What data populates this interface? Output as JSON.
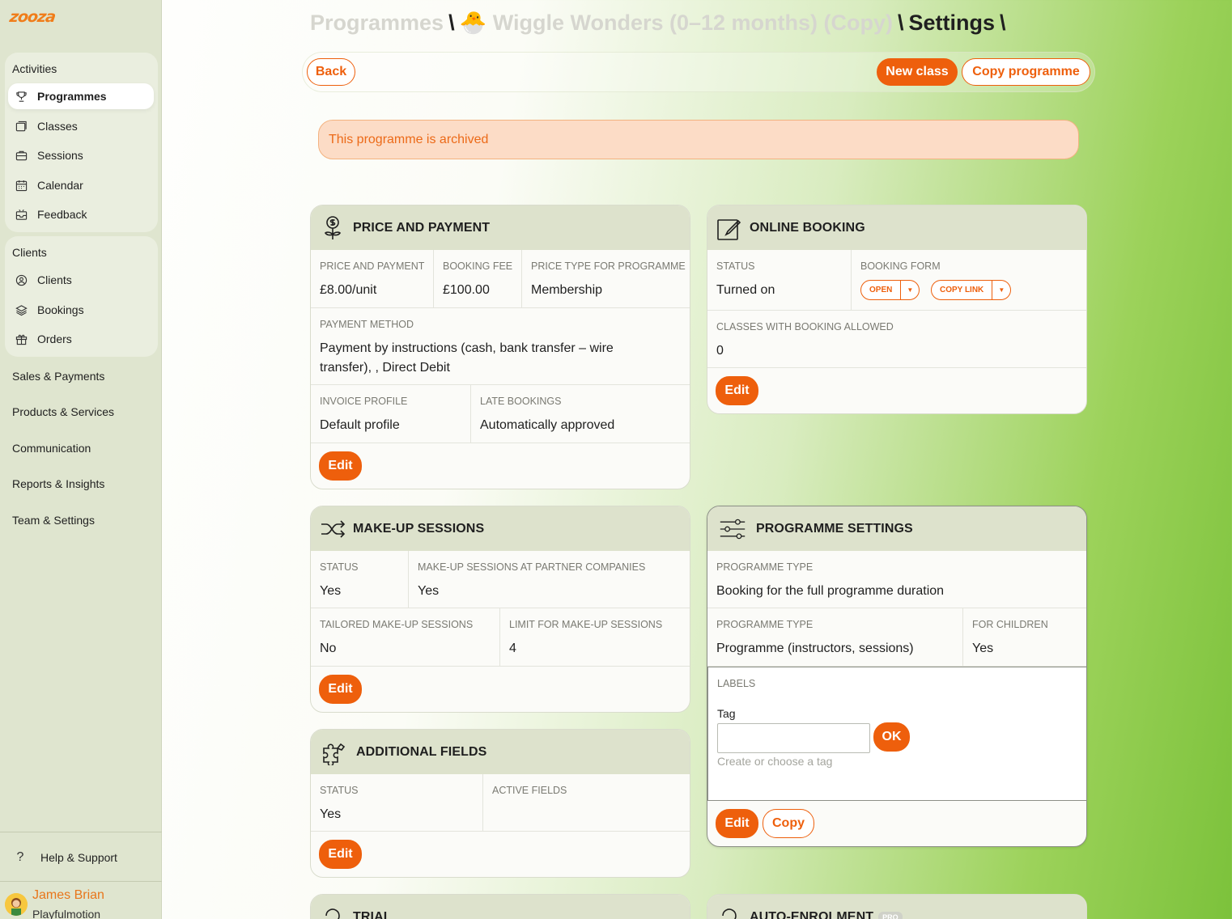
{
  "app": {
    "logo_text": "zooza",
    "brand_color": "#ee5f0c"
  },
  "sidebar": {
    "activities": {
      "title": "Activities",
      "items": [
        {
          "label": "Programmes",
          "icon": "trophy-icon",
          "active": true
        },
        {
          "label": "Classes",
          "icon": "folder-icon",
          "active": false
        },
        {
          "label": "Sessions",
          "icon": "briefcase-icon",
          "active": false
        },
        {
          "label": "Calendar",
          "icon": "calendar-icon",
          "active": false
        },
        {
          "label": "Feedback",
          "icon": "inbox-icon",
          "active": false
        }
      ]
    },
    "clients": {
      "title": "Clients",
      "items": [
        {
          "label": "Clients",
          "icon": "users-icon"
        },
        {
          "label": "Bookings",
          "icon": "layers-icon"
        },
        {
          "label": "Orders",
          "icon": "gift-icon"
        }
      ]
    },
    "links": [
      "Sales & Payments",
      "Products & Services",
      "Communication",
      "Reports & Insights",
      "Team & Settings"
    ],
    "help": "Help & Support",
    "help_icon": "question-icon",
    "user": {
      "name": "James Brian",
      "org": "Playfulmotion"
    }
  },
  "header": {
    "breadcrumb": {
      "root": "Programmes",
      "programme": "🐣 Wiggle Wonders (0–12 months) (Copy)",
      "current": "Settings",
      "sep": "\\"
    },
    "back_label": "Back",
    "new_class_label": "New class",
    "copy_programme_label": "Copy programme"
  },
  "alert": {
    "text": "This programme is archived"
  },
  "price_payment": {
    "title": "PRICE AND PAYMENT",
    "price_label": "PRICE AND PAYMENT",
    "price_value": "£8.00/unit",
    "fee_label": "BOOKING FEE",
    "fee_value": "£100.00",
    "price_type_label": "PRICE TYPE FOR PROGRAMME",
    "price_type_value": "Membership",
    "method_label": "PAYMENT METHOD",
    "method_value": "Payment by instructions (cash, bank transfer – wire transfer), , Direct Debit",
    "invoice_label": "INVOICE PROFILE",
    "invoice_value": "Default profile",
    "late_label": "LATE BOOKINGS",
    "late_value": "Automatically approved",
    "edit_label": "Edit"
  },
  "online_booking": {
    "title": "ONLINE BOOKING",
    "status_label": "STATUS",
    "status_value": "Turned on",
    "form_label": "BOOKING FORM",
    "open_label": "OPEN",
    "copy_link_label": "COPY LINK",
    "classes_label": "CLASSES WITH BOOKING ALLOWED",
    "classes_value": "0",
    "edit_label": "Edit"
  },
  "makeup": {
    "title": "MAKE-UP SESSIONS",
    "status_label": "STATUS",
    "status_value": "Yes",
    "partner_label": "MAKE-UP SESSIONS AT PARTNER COMPANIES",
    "partner_value": "Yes",
    "tailored_label": "TAILORED MAKE-UP SESSIONS",
    "tailored_value": "No",
    "limit_label": "LIMIT FOR MAKE-UP SESSIONS",
    "limit_value": "4",
    "edit_label": "Edit"
  },
  "programme_settings": {
    "title": "PROGRAMME SETTINGS",
    "type1_label": "PROGRAMME TYPE",
    "type1_value": "Booking for the full programme duration",
    "type2_label": "PROGRAMME TYPE",
    "type2_value": "Programme (instructors, sessions)",
    "children_label": "FOR CHILDREN",
    "children_value": "Yes",
    "labels_label": "LABELS",
    "tag_label": "Tag",
    "tag_value": "",
    "ok_label": "OK",
    "tag_hint": "Create or choose a tag",
    "edit_label": "Edit",
    "copy_label": "Copy"
  },
  "additional_fields": {
    "title": "ADDITIONAL FIELDS",
    "status_label": "STATUS",
    "status_value": "Yes",
    "active_label": "ACTIVE FIELDS",
    "active_value": "",
    "edit_label": "Edit"
  },
  "trial": {
    "title": "TRIAL"
  },
  "auto_enrolment": {
    "title": "AUTO-ENROLMENT",
    "badge": "PRO"
  }
}
